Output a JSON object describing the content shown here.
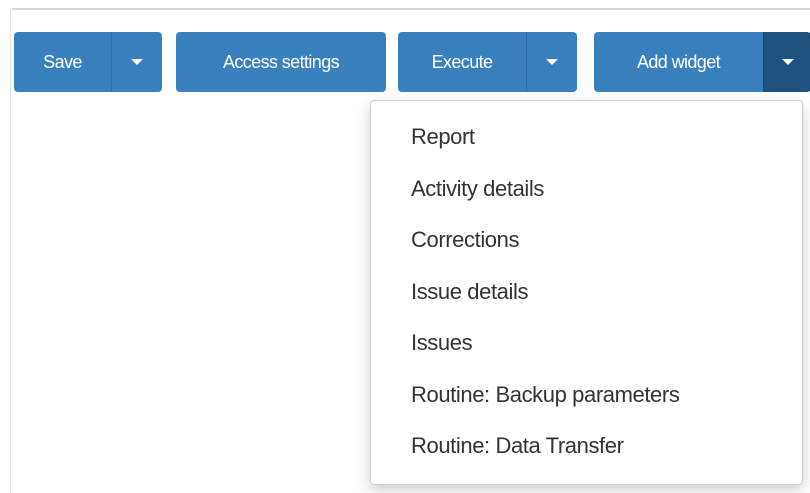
{
  "toolbar": {
    "save_label": "Save",
    "access_settings_label": "Access settings",
    "execute_label": "Execute",
    "add_widget_label": "Add widget"
  },
  "add_widget_menu": {
    "open": true,
    "items": [
      "Report",
      "Activity details",
      "Corrections",
      "Issue details",
      "Issues",
      "Routine: Backup parameters",
      "Routine: Data Transfer"
    ]
  },
  "colors": {
    "button": "#3a80bf",
    "button_active": "#1f527f",
    "menu_text": "#333333"
  }
}
